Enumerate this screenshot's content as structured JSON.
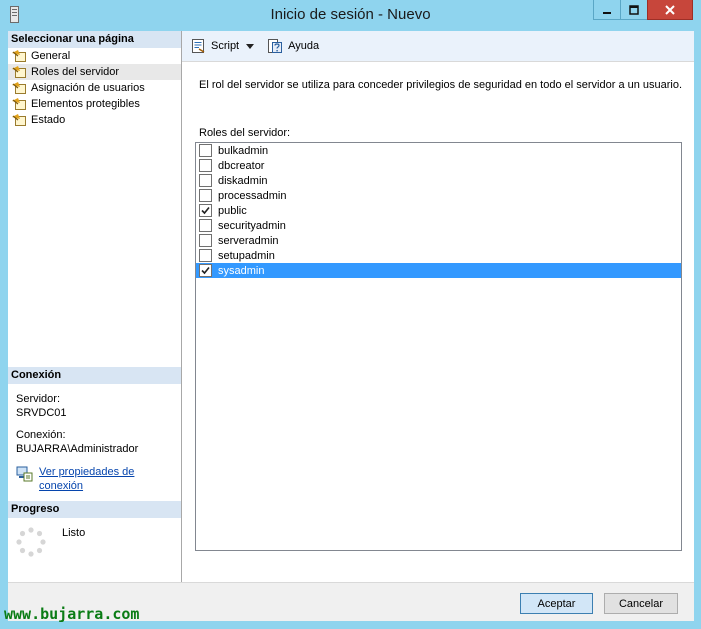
{
  "window": {
    "title": "Inicio de sesión - Nuevo"
  },
  "sidebar": {
    "header": "Seleccionar una página",
    "items": [
      {
        "label": "General",
        "selected": false
      },
      {
        "label": "Roles del servidor",
        "selected": true
      },
      {
        "label": "Asignación de usuarios",
        "selected": false
      },
      {
        "label": "Elementos protegibles",
        "selected": false
      },
      {
        "label": "Estado",
        "selected": false
      }
    ]
  },
  "connection": {
    "header": "Conexión",
    "server_label": "Servidor:",
    "server_value": "SRVDC01",
    "connection_label": "Conexión:",
    "connection_value": "BUJARRA\\Administrador",
    "link_line1": "Ver propiedades de",
    "link_line2": "conexión"
  },
  "progress": {
    "header": "Progreso",
    "status": "Listo"
  },
  "toolbar": {
    "script_label": "Script",
    "help_label": "Ayuda"
  },
  "main": {
    "description": "El rol del servidor se utiliza para conceder privilegios de seguridad en todo el servidor a un usuario.",
    "roles_label": "Roles del servidor:",
    "roles": [
      {
        "name": "bulkadmin",
        "checked": false,
        "selected": false
      },
      {
        "name": "dbcreator",
        "checked": false,
        "selected": false
      },
      {
        "name": "diskadmin",
        "checked": false,
        "selected": false
      },
      {
        "name": "processadmin",
        "checked": false,
        "selected": false
      },
      {
        "name": "public",
        "checked": true,
        "selected": false
      },
      {
        "name": "securityadmin",
        "checked": false,
        "selected": false
      },
      {
        "name": "serveradmin",
        "checked": false,
        "selected": false
      },
      {
        "name": "setupadmin",
        "checked": false,
        "selected": false
      },
      {
        "name": "sysadmin",
        "checked": true,
        "selected": true
      }
    ]
  },
  "footer": {
    "ok_label": "Aceptar",
    "cancel_label": "Cancelar"
  },
  "watermark": "www.bujarra.com",
  "colors": {
    "accent": "#3399ff",
    "frame": "#8fd4ee",
    "close": "#c7463b",
    "watermark": "#0a7c15"
  }
}
